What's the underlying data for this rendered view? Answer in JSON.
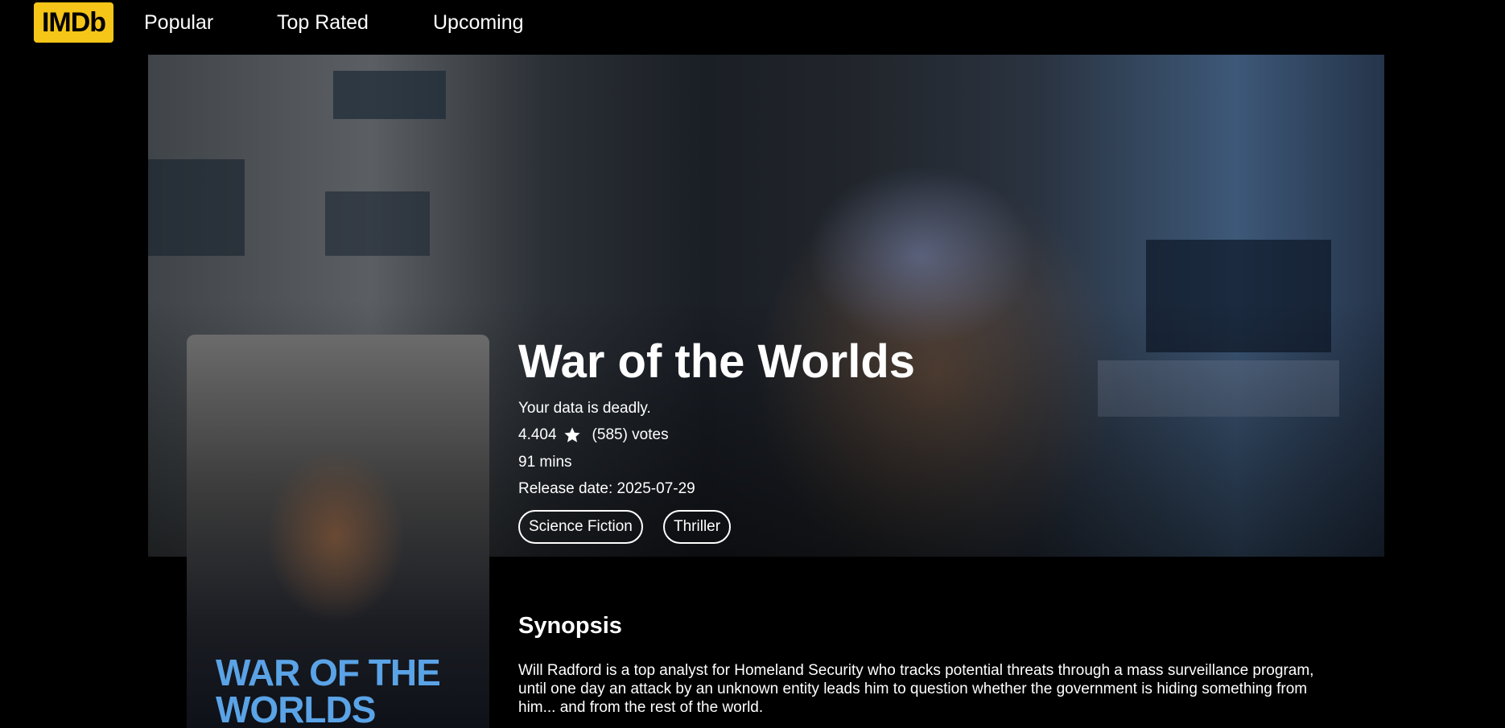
{
  "header": {
    "logo_text": "IMDb",
    "nav": [
      {
        "label": "Popular"
      },
      {
        "label": "Top Rated"
      },
      {
        "label": "Upcoming"
      }
    ]
  },
  "colors": {
    "brand_yellow": "#f5c518",
    "background": "#000000",
    "poster_title_blue": "#5aa3e6"
  },
  "movie": {
    "title": "War of the Worlds",
    "tagline": "Your data is deadly.",
    "rating": "4.404",
    "rating_icon": "star-icon",
    "votes": "(585) votes",
    "runtime": "91 mins",
    "release": "Release date: 2025-07-29",
    "genres": [
      "Science Fiction",
      "Thriller"
    ],
    "poster_title": "WAR OF THE WORLDS"
  },
  "synopsis": {
    "heading": "Synopsis",
    "text": "Will Radford is a top analyst for Homeland Security who tracks potential threats through a mass surveillance program, until one day an attack by an unknown entity leads him to question whether the government is hiding something from him... and from the rest of the world."
  }
}
